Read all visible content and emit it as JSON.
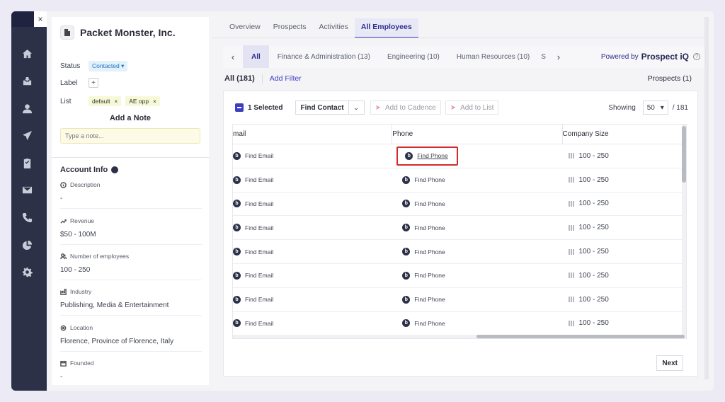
{
  "nav": {
    "close_label": "×",
    "icons": [
      "home-icon",
      "inbox-icon",
      "user-icon",
      "send-icon",
      "clipboard-icon",
      "mail-icon",
      "phone-icon",
      "pie-chart-icon",
      "gear-icon"
    ]
  },
  "account": {
    "name": "Packet Monster, Inc.",
    "status_label": "Status",
    "status_value": "Contacted",
    "label_label": "Label",
    "plus": "+",
    "list_label": "List",
    "list_tags": [
      "default",
      "AE opp"
    ],
    "tag_remove": "×",
    "add_note_title": "Add a Note",
    "note_placeholder": "Type a note...",
    "info_title": "Account Info",
    "info_badge": "b",
    "fields": [
      {
        "label": "Description",
        "value": "-"
      },
      {
        "label": "Revenue",
        "value": "$50 - 100M"
      },
      {
        "label": "Number of employees",
        "value": "100 - 250"
      },
      {
        "label": "Industry",
        "value": "Publishing, Media & Entertainment"
      },
      {
        "label": "Location",
        "value": "Florence, Province of Florence, Italy"
      },
      {
        "label": "Founded",
        "value": "-"
      }
    ]
  },
  "tabs": [
    "Overview",
    "Prospects",
    "Activities",
    "All Employees"
  ],
  "subtabs": {
    "prev": "‹",
    "next": "›",
    "items": [
      "All",
      "Finance & Administration (13)",
      "Engineering (10)",
      "Human Resources (10)",
      "S"
    ],
    "powered_by": "Powered by",
    "brand": "Prospect iQ",
    "help": "?"
  },
  "filter": {
    "all": "All  (181)",
    "add_filter": "Add Filter",
    "prospects": "Prospects (1)"
  },
  "toolbar": {
    "selected": "1 Selected",
    "find_contact": "Find Contact",
    "dropdown": "⌄",
    "add_cadence": "Add to Cadence",
    "add_list": "Add to List",
    "showing": "Showing",
    "page_size": "50",
    "total": "/ 181",
    "caret": "▾"
  },
  "table": {
    "headers": [
      "mail",
      "Phone",
      "Company Size"
    ],
    "rows": [
      {
        "email": "Find Email",
        "phone": "Find Phone",
        "size": "100 - 250"
      },
      {
        "email": "Find Email",
        "phone": "Find Phone",
        "size": "100 - 250"
      },
      {
        "email": "Find Email",
        "phone": "Find Phone",
        "size": "100 - 250"
      },
      {
        "email": "Find Email",
        "phone": "Find Phone",
        "size": "100 - 250"
      },
      {
        "email": "Find Email",
        "phone": "Find Phone",
        "size": "100 - 250"
      },
      {
        "email": "Find Email",
        "phone": "Find Phone",
        "size": "100 - 250"
      },
      {
        "email": "Find Email",
        "phone": "Find Phone",
        "size": "100 - 250"
      },
      {
        "email": "Find Email",
        "phone": "Find Phone",
        "size": "100 - 250"
      }
    ],
    "badge": "b"
  },
  "pagination": {
    "next": "Next"
  },
  "colors": {
    "accent": "#3d3fc2",
    "nav_bg": "#2c3148",
    "highlight": "#d32b2b"
  }
}
